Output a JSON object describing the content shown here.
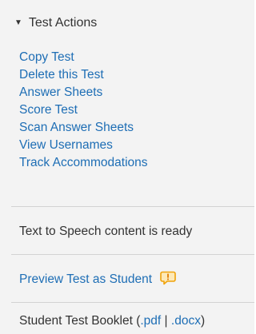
{
  "header": {
    "caret": "▼",
    "title": "Test Actions"
  },
  "actions": [
    "Copy Test",
    "Delete this Test",
    "Answer Sheets",
    "Score Test",
    "Scan Answer Sheets",
    "View Usernames",
    "Track Accommodations"
  ],
  "tts_status": "Text to Speech content is ready",
  "preview": {
    "label": "Preview Test as Student",
    "icon": "alert-speech-bubble-icon",
    "icon_color": "#f0a30a"
  },
  "booklet": {
    "label": "Student Test Booklet (",
    "pdf": ".pdf",
    "separator": "|",
    "docx": ".docx",
    "close": ")"
  },
  "colors": {
    "link": "#1e6eb5",
    "text": "#333333",
    "background": "#f3f3f3",
    "divider": "#d3d3d3"
  }
}
